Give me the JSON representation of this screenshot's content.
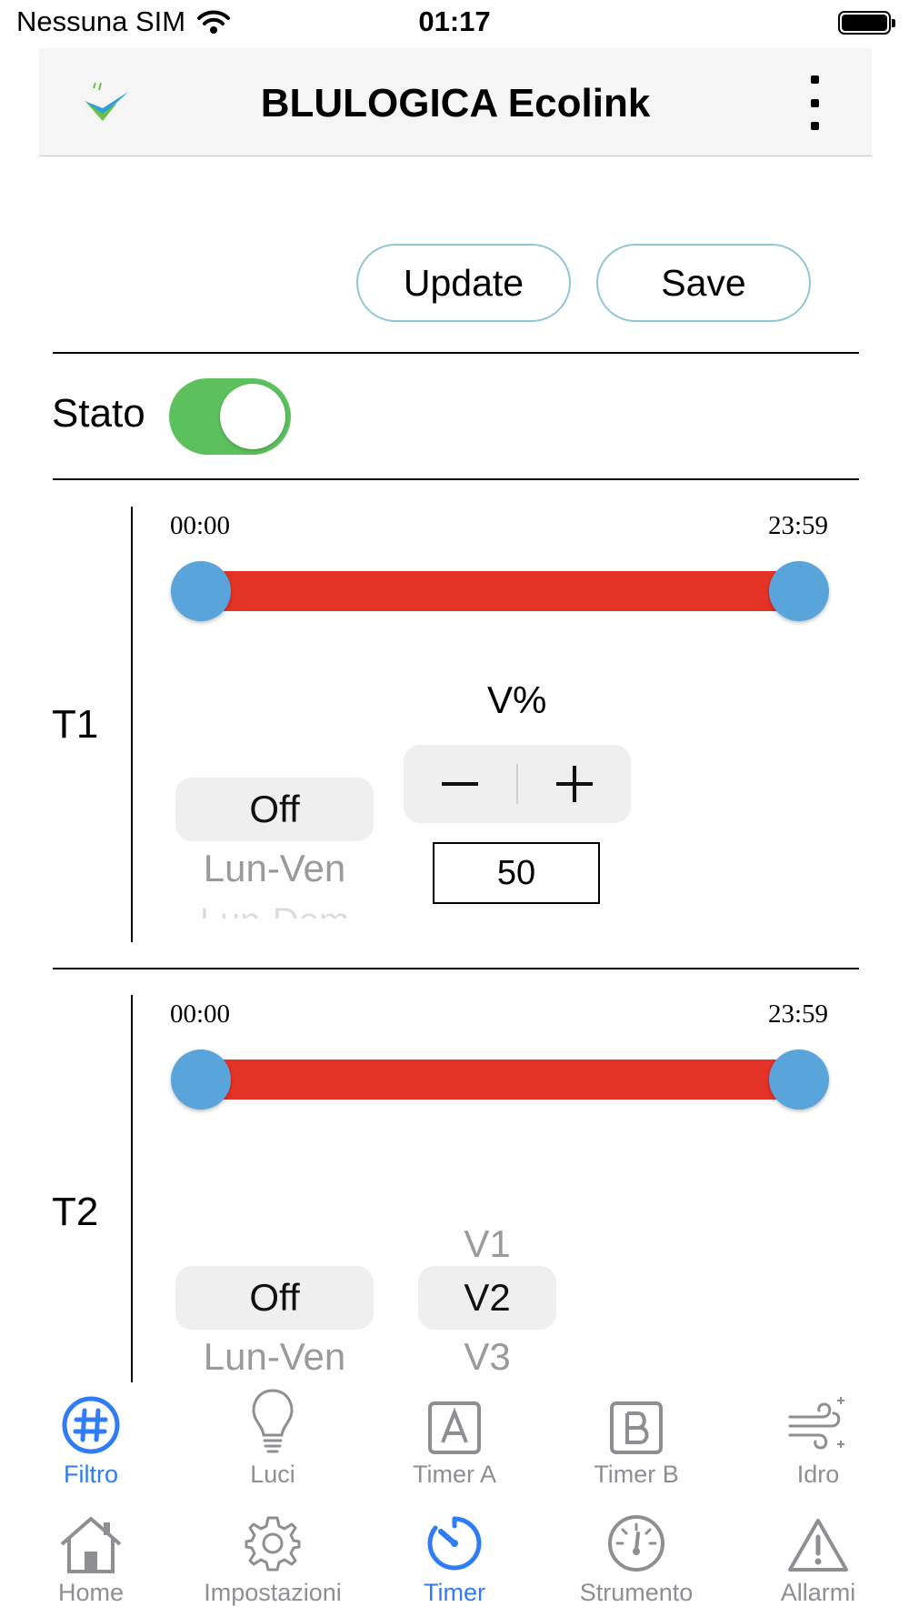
{
  "status_bar": {
    "carrier": "Nessuna SIM",
    "time": "01:17"
  },
  "header": {
    "title": "BLULOGICA Ecolink"
  },
  "actions": {
    "update_label": "Update",
    "save_label": "Save"
  },
  "stato": {
    "label": "Stato",
    "enabled": true
  },
  "timers": [
    {
      "label": "T1",
      "start_label": "00:00",
      "end_label": "23:59",
      "range_start_fraction": 0,
      "range_end_fraction": 1,
      "day_picker": {
        "selected": "Off",
        "next": "Lun-Ven",
        "after": "Lun-Dom"
      },
      "speed_label": "V%",
      "stepper": {
        "minus": "−",
        "plus": "+"
      },
      "speed_value": "50"
    },
    {
      "label": "T2",
      "start_label": "00:00",
      "end_label": "23:59",
      "range_start_fraction": 0,
      "range_end_fraction": 1,
      "day_picker": {
        "selected": "Off",
        "next": "Lun-Ven"
      },
      "speed_picker": {
        "previous": "V1",
        "selected": "V2",
        "next": "V3"
      }
    }
  ],
  "top_tabs": [
    {
      "label": "Filtro",
      "icon": "grid-hash-icon",
      "active": true
    },
    {
      "label": "Luci",
      "icon": "lightbulb-icon",
      "active": false
    },
    {
      "label": "Timer A",
      "icon": "letter-a-icon",
      "active": false
    },
    {
      "label": "Timer B",
      "icon": "letter-b-icon",
      "active": false
    },
    {
      "label": "Idro",
      "icon": "wind-icon",
      "active": false
    }
  ],
  "bottom_tabs": [
    {
      "label": "Home",
      "icon": "home-icon",
      "active": false
    },
    {
      "label": "Impostazioni",
      "icon": "gear-icon",
      "active": false
    },
    {
      "label": "Timer",
      "icon": "timer-icon",
      "active": true
    },
    {
      "label": "Strumento",
      "icon": "gauge-icon",
      "active": false
    },
    {
      "label": "Allarmi",
      "icon": "warning-icon",
      "active": false
    }
  ],
  "colors": {
    "accent": "#2f7cf6",
    "inactive": "#8e8e93",
    "toggle_on": "#5cc15c",
    "range_track": "#e53226",
    "range_thumb": "#5aa4dc",
    "button_border": "#8fc7d6"
  }
}
